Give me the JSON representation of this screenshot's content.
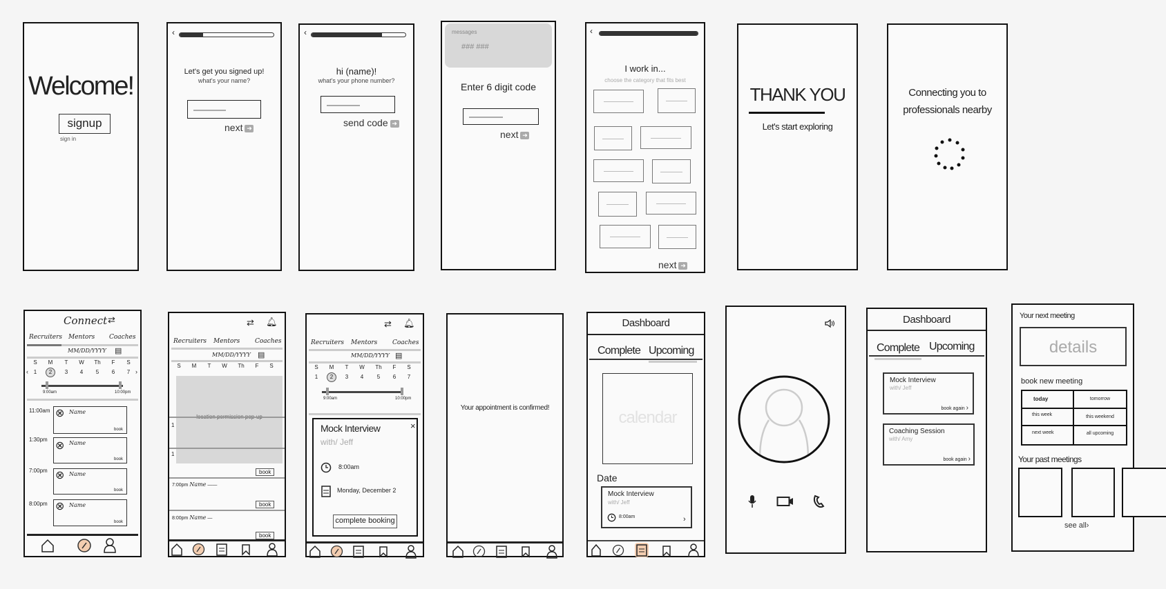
{
  "screens": {
    "welcome": {
      "title": "Welcome!",
      "signup_label": "signup",
      "signin_label": "sign in"
    },
    "name": {
      "title": "Let's get you signed up!",
      "subtitle": "what's your name?",
      "next_label": "next",
      "progress": 0.25
    },
    "phone": {
      "title": "hi (name)!",
      "subtitle": "what's your phone number?",
      "send_label": "send code",
      "progress": 0.75
    },
    "code": {
      "messages_label": "messages",
      "messages_code": "### ###",
      "title": "Enter 6 digit code",
      "next_label": "next"
    },
    "category": {
      "title": "I work in...",
      "subtitle": "choose the category that fits best",
      "next_label": "next",
      "progress": 1.0
    },
    "thanks": {
      "title": "THANK YOU",
      "subtitle": "Let's start exploring"
    },
    "connecting": {
      "line1": "Connecting you to",
      "line2": "professionals nearby"
    },
    "connect": {
      "title": "Connect",
      "tabs": [
        "Recruiters",
        "Mentors",
        "Coaches"
      ],
      "date_placeholder": "MM/DD/YYYY",
      "days": [
        "S",
        "M",
        "T",
        "W",
        "Th",
        "F",
        "S"
      ],
      "dates": [
        "1",
        "2",
        "3",
        "4",
        "5",
        "6",
        "7"
      ],
      "selected_date": "2",
      "slider_min": "9:00am",
      "slider_max": "10:00pm",
      "slots": [
        {
          "time": "11:00am",
          "name": "Name",
          "action": "book"
        },
        {
          "time": "1:30pm",
          "name": "Name",
          "action": "book"
        },
        {
          "time": "7:00pm",
          "name": "Name",
          "action": "book"
        },
        {
          "time": "8:00pm",
          "name": "Name",
          "action": "book"
        }
      ]
    },
    "location": {
      "popup_text": "location permission pop-up",
      "book_label": "book",
      "partial_1": "1",
      "rows": [
        {
          "time": "7:00pm",
          "name": "Name"
        },
        {
          "time": "8:00pm",
          "name": "Name"
        }
      ]
    },
    "booking": {
      "title": "Mock Interview",
      "with": "with/ Jeff",
      "time": "8:00am",
      "date": "Monday, December 2",
      "close": "×",
      "button": "complete booking"
    },
    "confirmed": {
      "text": "Your appointment is confirmed!"
    },
    "dashboard_upcoming": {
      "title": "Dashboard",
      "tabs": [
        "Complete",
        "Upcoming"
      ],
      "active_tab": "Upcoming",
      "calendar_placeholder": "calendar",
      "date_label": "Date",
      "card": {
        "title": "Mock Interview",
        "with": "with/ Jeff",
        "time": "8:00am"
      }
    },
    "dashboard_complete": {
      "title": "Dashboard",
      "tabs": [
        "Complete",
        "Upcoming"
      ],
      "active_tab": "Complete",
      "cards": [
        {
          "title": "Mock Interview",
          "with": "with/ Jeff",
          "action": "book again"
        },
        {
          "title": "Coaching Session",
          "with": "with/ Amy",
          "action": "book again"
        }
      ]
    },
    "home": {
      "next_meeting": "Your next meeting",
      "details": "details",
      "book_new": "book new meeting",
      "options": [
        "today",
        "tomorrow",
        "this week",
        "this weekend",
        "next week",
        "all upcoming"
      ],
      "past": "Your past meetings",
      "see_all": "see all"
    }
  },
  "colors": {
    "ink": "#111111",
    "highlight": "#f3cdb0",
    "placeholder_gray": "#d8d8d8",
    "faint_text": "#aaaaaa"
  }
}
